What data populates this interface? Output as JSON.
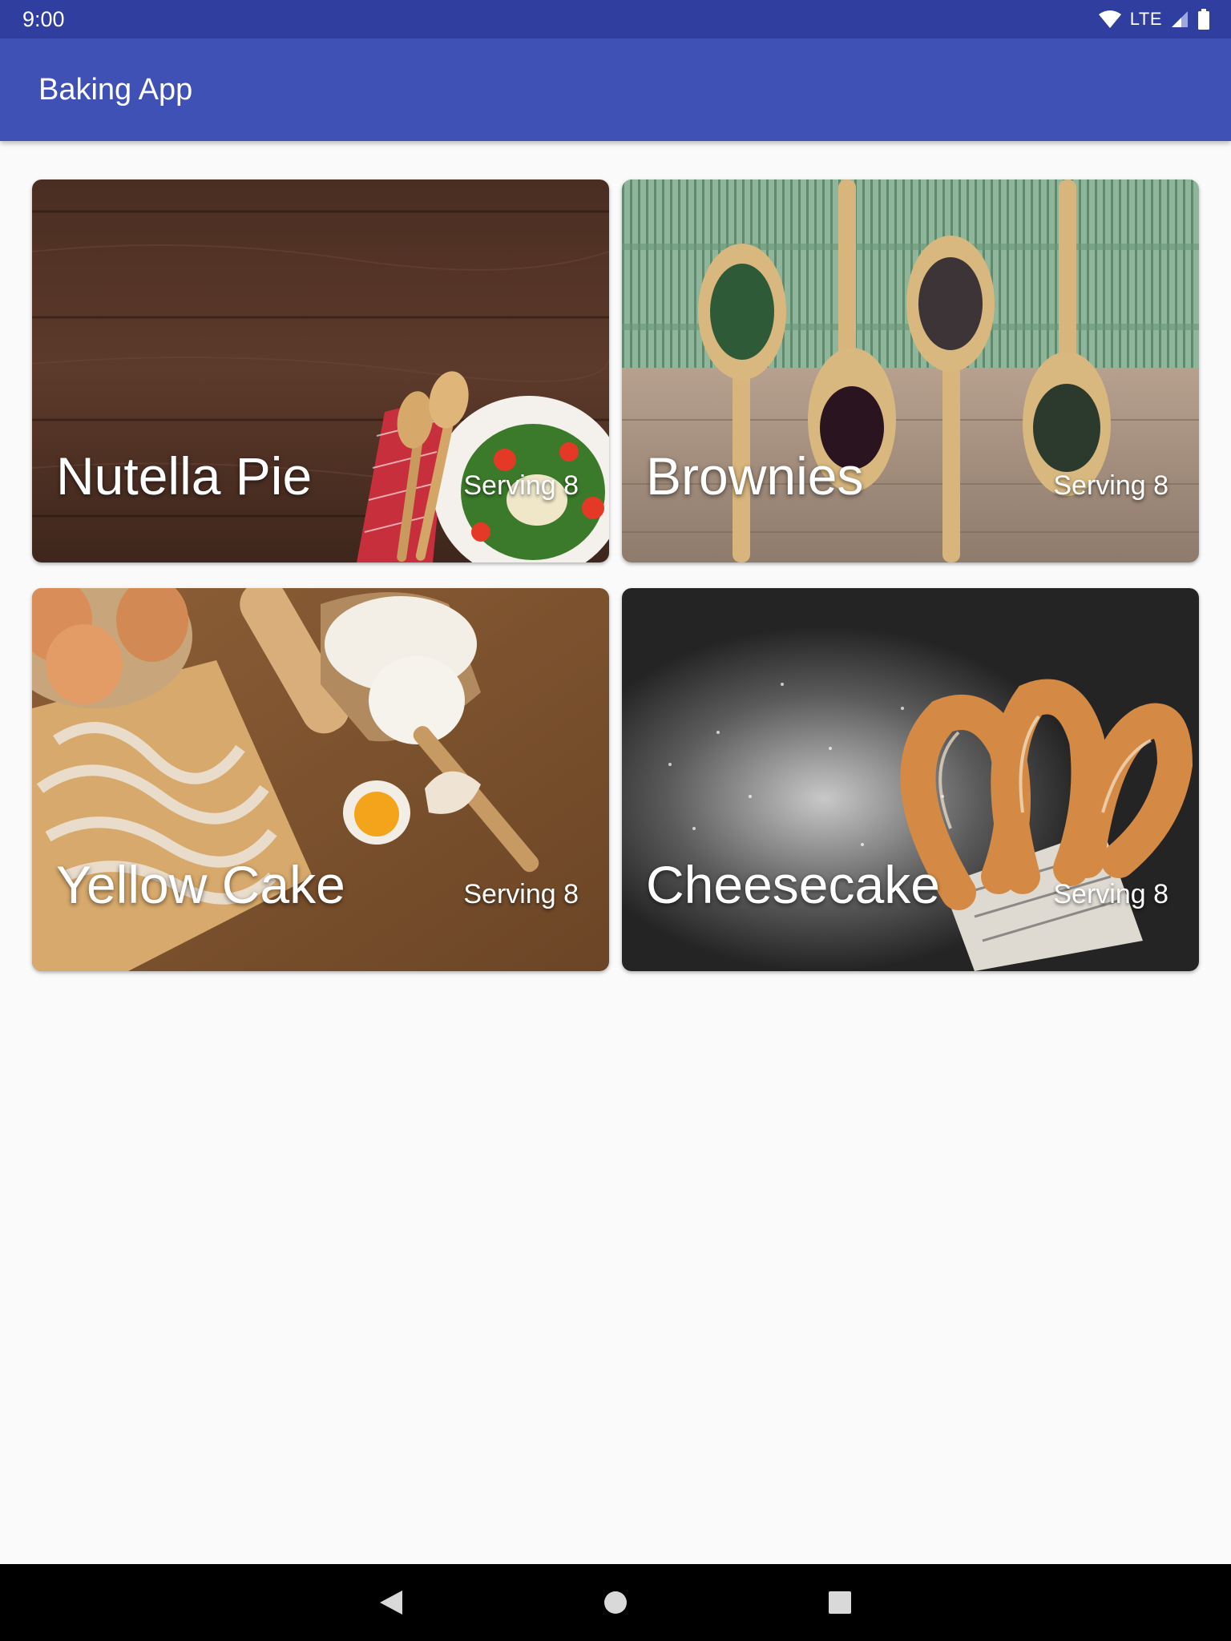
{
  "status_bar": {
    "time": "9:00",
    "network": "LTE",
    "icons": [
      "wifi-icon",
      "cell-signal-icon",
      "battery-icon"
    ]
  },
  "app_bar": {
    "title": "Baking App",
    "color": "#3f51b5"
  },
  "recipes": [
    {
      "name": "Nutella Pie",
      "servings": "Serving 8",
      "image": "wooden-table-salad-photo"
    },
    {
      "name": "Brownies",
      "servings": "Serving 8",
      "image": "wooden-spoons-spices-photo"
    },
    {
      "name": "Yellow Cake",
      "servings": "Serving 8",
      "image": "flour-eggs-pasta-photo"
    },
    {
      "name": "Cheesecake",
      "servings": "Serving 8",
      "image": "churros-powdered-sugar-photo"
    }
  ],
  "nav_bar": {
    "icons": [
      "back-icon",
      "home-icon",
      "recents-icon"
    ]
  }
}
